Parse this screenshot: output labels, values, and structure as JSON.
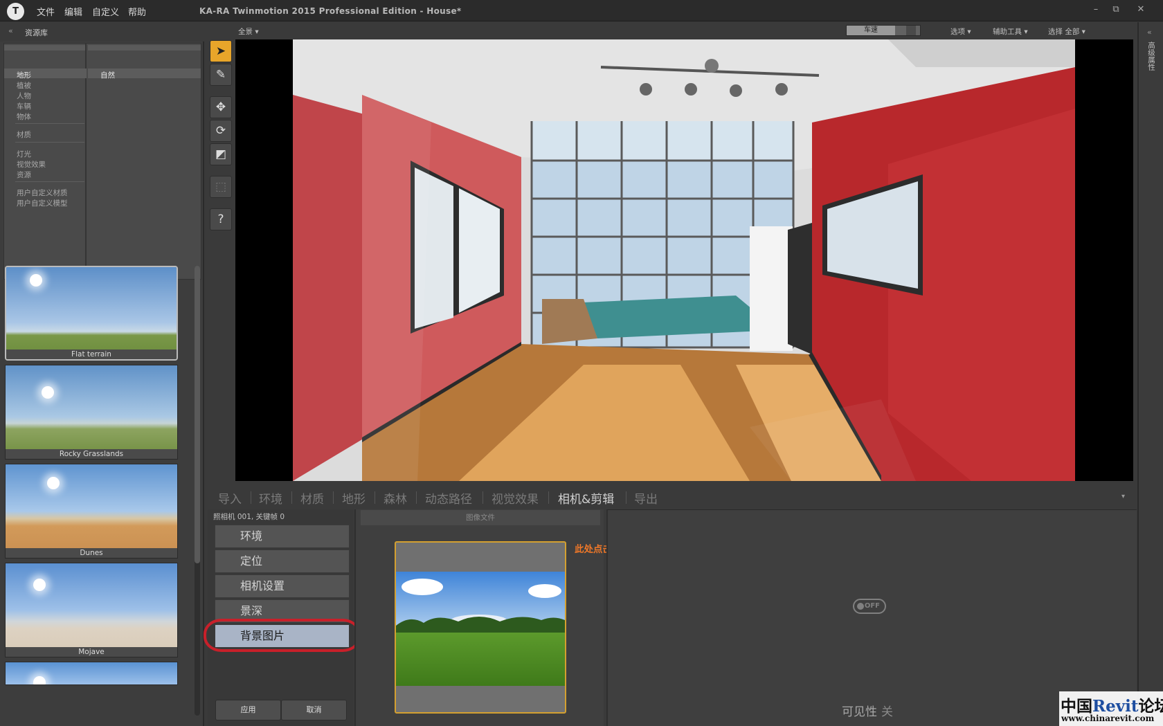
{
  "titlebar": {
    "logo": "T",
    "menus": [
      "文件",
      "编辑",
      "自定义",
      "帮助"
    ],
    "title": "KA-RA Twinmotion 2015 Professional Edition - House*",
    "window_buttons": {
      "minimize": "–",
      "restore": "⧉",
      "close": "✕"
    }
  },
  "library": {
    "collapse_icon": "«",
    "title": "资源库",
    "col1": [
      "地形",
      "植被",
      "人物",
      "车辆",
      "物体",
      "材质",
      "灯光",
      "视觉效果",
      "资源",
      "用户自定义材质",
      "用户自定义模型"
    ],
    "col2": [
      "自然"
    ],
    "thumbnails": [
      {
        "label": "Flat terrain"
      },
      {
        "label": "Rocky Grasslands"
      },
      {
        "label": "Dunes"
      },
      {
        "label": "Mojave"
      },
      {
        "label": ""
      }
    ]
  },
  "tools": {
    "icons": [
      "select-arrow-icon",
      "eyedropper-icon",
      "move-icon",
      "rotate-icon",
      "scale-icon",
      "frame-icon",
      "help-icon"
    ],
    "glyphs": [
      "➤",
      "✎",
      "✥",
      "⟳",
      "◩",
      "⬚",
      "?"
    ]
  },
  "viewport_bar": {
    "view": "全景 ▾",
    "speed_label": "车速",
    "options": "选项 ▾",
    "assist": "辅助工具 ▾",
    "select": "选择 全部 ▾"
  },
  "right_strip": {
    "collapse_icon": "«",
    "label": "高级属性"
  },
  "tabs": [
    "导入",
    "环境",
    "材质",
    "地形",
    "森林",
    "动态路径",
    "视觉效果",
    "相机&剪辑",
    "导出"
  ],
  "active_tab": 7,
  "tab_collapse": "▾",
  "camera": {
    "info": "照相机 001, 关键帧 0",
    "items": [
      "环境",
      "定位",
      "相机设置",
      "景深",
      "背景图片"
    ],
    "selected": 4,
    "apply": "应用",
    "cancel": "取消"
  },
  "image_panel": {
    "header": "图像文件",
    "annotation": "此处点击“添加”，选择背景图片。"
  },
  "properties": {
    "toggle": "OFF",
    "visibility_label": "可见性",
    "visibility_value": "关"
  },
  "watermark": {
    "part1": "中国",
    "part2": "Revit",
    "part3": "论坛",
    "url": "www.chinarevit.com"
  },
  "colors": {
    "accent": "#e8a52a",
    "selection": "#a9b4c6",
    "annotation": "#f07828",
    "highlight": "#c8202a"
  }
}
